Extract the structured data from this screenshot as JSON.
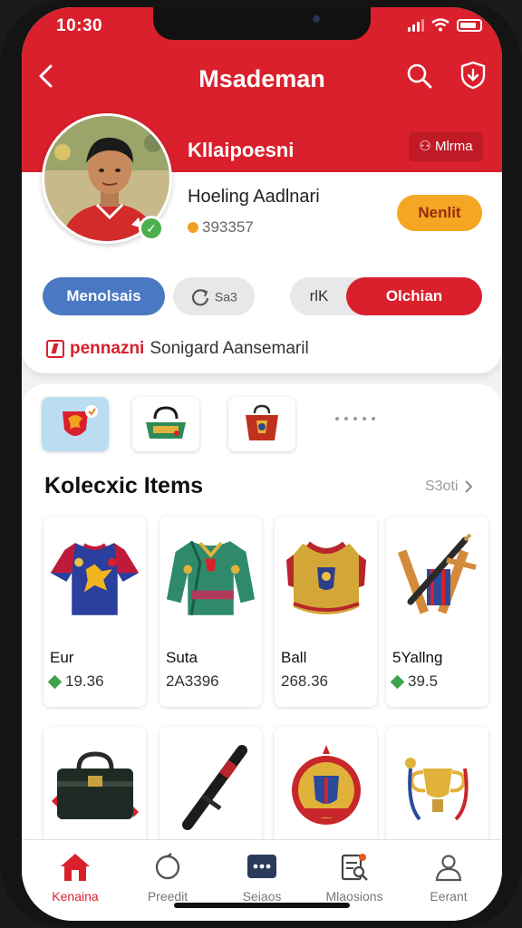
{
  "status_bar": {
    "time": "10:30"
  },
  "nav": {
    "title": "Msademan"
  },
  "profile": {
    "name": "Kllaipoesni",
    "tag": "Mlrma",
    "subtitle": "Hoeling Aadlnari",
    "coins": "393357",
    "follow_label": "Nenlit"
  },
  "actions": {
    "primary_label": "Menolsais",
    "secondary_label": "Sa3",
    "toggle_left_label": "rlK",
    "toggle_right_label": "Olchian"
  },
  "info": {
    "brand": "pennazni",
    "text": "Sonigard Aansemaril"
  },
  "categories": [
    {
      "icon": "dragon-shield-icon",
      "active": true
    },
    {
      "icon": "bag-icon",
      "active": false
    },
    {
      "icon": "crest-icon",
      "active": false
    }
  ],
  "section": {
    "title": "Kolecxic Items",
    "more_label": "S3oti"
  },
  "items": [
    {
      "name": "Eur",
      "price": "19.36",
      "icon": "jersey-icon"
    },
    {
      "name": "Suta",
      "price": "2A3396",
      "icon": "jacket-icon"
    },
    {
      "name": "Ball",
      "price": "268.36",
      "icon": "armor-icon"
    },
    {
      "name": "5Yallng",
      "price": "39.5",
      "icon": "bat-icon"
    }
  ],
  "items_row2": [
    {
      "icon": "briefcase-icon"
    },
    {
      "icon": "baton-icon"
    },
    {
      "icon": "medal-icon"
    },
    {
      "icon": "trophy-icon"
    }
  ],
  "tabs": [
    {
      "label": "Kenaina",
      "icon": "home-icon",
      "active": true
    },
    {
      "label": "Preedit",
      "icon": "circle-icon",
      "active": false
    },
    {
      "label": "Seiaos",
      "icon": "chat-icon",
      "active": false
    },
    {
      "label": "Mlaosions",
      "icon": "search-doc-icon",
      "active": false
    },
    {
      "label": "Eerant",
      "icon": "person-icon",
      "active": false
    }
  ],
  "colors": {
    "brand_red": "#d9202c",
    "accent_orange": "#f5a623",
    "accent_blue": "#4a78c2",
    "gem_green": "#3fa34d"
  }
}
